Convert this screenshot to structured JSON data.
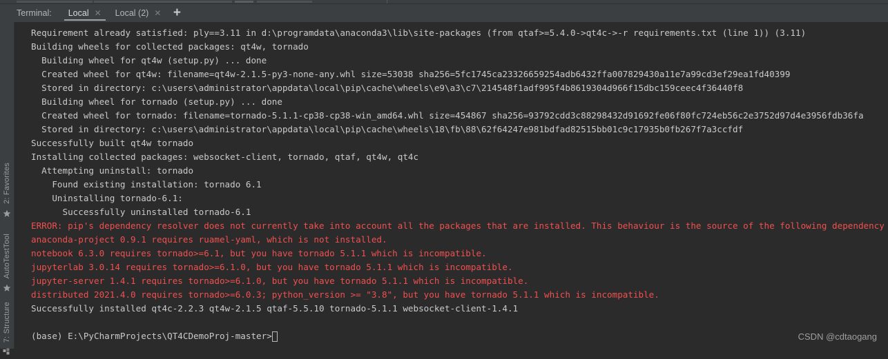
{
  "window": {
    "background_color": "#3c3f41",
    "console_background_color": "#2b2b2b",
    "normal_text_color": "#c8cacc",
    "error_text_color": "#f05050"
  },
  "terminal_tabs": {
    "title": "Terminal:",
    "tabs": [
      {
        "label": "Local",
        "active": true,
        "close_icon": "close-icon"
      },
      {
        "label": "Local (2)",
        "active": false,
        "close_icon": "close-icon"
      }
    ],
    "add_tab_label": "+"
  },
  "side_rail": {
    "items": [
      {
        "label": "2: Favorites",
        "underline_char": "2",
        "icon": "star-icon"
      },
      {
        "label": "AutoTestTool",
        "underline_char": "",
        "icon": "star-icon"
      },
      {
        "label": "7: Structure",
        "underline_char": "7",
        "icon": "grid-icon"
      }
    ]
  },
  "console": {
    "lines": [
      {
        "type": "normal",
        "text": "Requirement already satisfied: ply==3.11 in d:\\programdata\\anaconda3\\lib\\site-packages (from qtaf>=5.4.0->qt4c->-r requirements.txt (line 1)) (3.11)"
      },
      {
        "type": "normal",
        "text": "Building wheels for collected packages: qt4w, tornado"
      },
      {
        "type": "normal",
        "text": "  Building wheel for qt4w (setup.py) ... done"
      },
      {
        "type": "normal",
        "text": "  Created wheel for qt4w: filename=qt4w-2.1.5-py3-none-any.whl size=53038 sha256=5fc1745ca23326659254adb6432ffa007829430a11e7a99cd3ef29ea1fd40399"
      },
      {
        "type": "normal",
        "text": "  Stored in directory: c:\\users\\administrator\\appdata\\local\\pip\\cache\\wheels\\e9\\a3\\c7\\214548f1adf995f4b8619304d966f15dbc159ceec4f36440f8"
      },
      {
        "type": "normal",
        "text": "  Building wheel for tornado (setup.py) ... done"
      },
      {
        "type": "normal",
        "text": "  Created wheel for tornado: filename=tornado-5.1.1-cp38-cp38-win_amd64.whl size=454867 sha256=93792cdd3c88298432d91692fe06f80fc724eb56c2e3752d97d4e3956fdb36fa"
      },
      {
        "type": "normal",
        "text": "  Stored in directory: c:\\users\\administrator\\appdata\\local\\pip\\cache\\wheels\\18\\fb\\88\\62f64247e981bdfad82515bb01c9c17935b0fb267f7a3ccfdf"
      },
      {
        "type": "normal",
        "text": "Successfully built qt4w tornado"
      },
      {
        "type": "normal",
        "text": "Installing collected packages: websocket-client, tornado, qtaf, qt4w, qt4c"
      },
      {
        "type": "normal",
        "text": "  Attempting uninstall: tornado"
      },
      {
        "type": "normal",
        "text": "    Found existing installation: tornado 6.1"
      },
      {
        "type": "normal",
        "text": "    Uninstalling tornado-6.1:"
      },
      {
        "type": "normal",
        "text": "      Successfully uninstalled tornado-6.1"
      },
      {
        "type": "error",
        "text": "ERROR: pip's dependency resolver does not currently take into account all the packages that are installed. This behaviour is the source of the following dependency conflicts."
      },
      {
        "type": "error",
        "text": "anaconda-project 0.9.1 requires ruamel-yaml, which is not installed."
      },
      {
        "type": "error",
        "text": "notebook 6.3.0 requires tornado>=6.1, but you have tornado 5.1.1 which is incompatible."
      },
      {
        "type": "error",
        "text": "jupyterlab 3.0.14 requires tornado>=6.1.0, but you have tornado 5.1.1 which is incompatible."
      },
      {
        "type": "error",
        "text": "jupyter-server 1.4.1 requires tornado>=6.1.0, but you have tornado 5.1.1 which is incompatible."
      },
      {
        "type": "error",
        "text": "distributed 2021.4.0 requires tornado>=6.0.3; python_version >= \"3.8\", but you have tornado 5.1.1 which is incompatible."
      },
      {
        "type": "normal",
        "text": "Successfully installed qt4c-2.2.3 qt4w-2.1.5 qtaf-5.5.10 tornado-5.1.1 websocket-client-1.4.1"
      },
      {
        "type": "blank",
        "text": " "
      }
    ],
    "prompt": "(base) E:\\PyCharmProjects\\QT4CDemoProj-master>"
  },
  "watermark": "CSDN @cdtaogang"
}
